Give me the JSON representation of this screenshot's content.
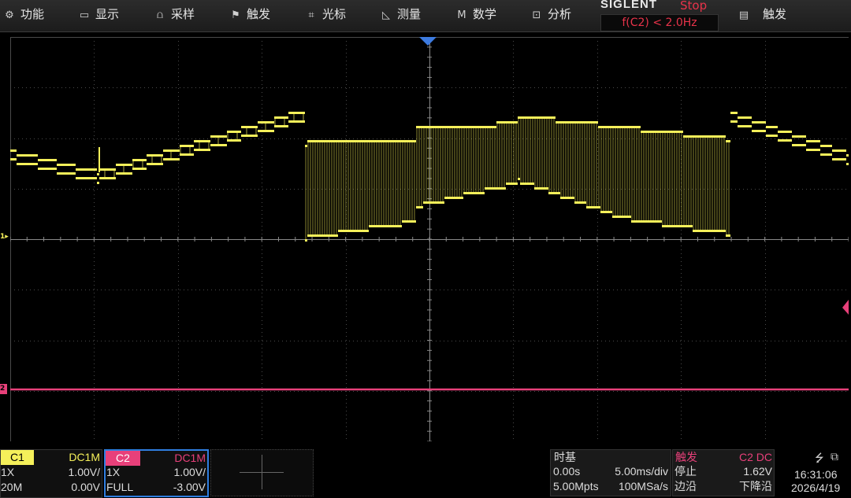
{
  "menu": {
    "items": [
      {
        "id": "function",
        "label": "功能",
        "icon": "gear-icon",
        "glyph": "⚙"
      },
      {
        "id": "display",
        "label": "显示",
        "icon": "monitor-icon",
        "glyph": "▭"
      },
      {
        "id": "acquire",
        "label": "采样",
        "icon": "acquire-icon",
        "glyph": "⩍"
      },
      {
        "id": "trigger",
        "label": "触发",
        "icon": "flag-icon",
        "glyph": "⚑"
      },
      {
        "id": "cursor",
        "label": "光标",
        "icon": "cursor-icon",
        "glyph": "⌗"
      },
      {
        "id": "measure",
        "label": "测量",
        "icon": "measure-icon",
        "glyph": "◺"
      },
      {
        "id": "math",
        "label": "数学",
        "icon": "math-icon",
        "glyph": "M"
      },
      {
        "id": "analyze",
        "label": "分析",
        "icon": "analyze-icon",
        "glyph": "⊡"
      },
      {
        "id": "trigger-menu",
        "label": "触发",
        "icon": "list-icon",
        "glyph": "▤"
      }
    ]
  },
  "brand": "SIGLENT",
  "run_status": "Stop",
  "frequency": "f(C2) < 2.0Hz",
  "markers": {
    "ch1": "1",
    "ch2": "2"
  },
  "ch1": {
    "name": "C1",
    "coupling": "DC1M",
    "probe": "1X",
    "scale": "1.00V/",
    "bw": "20M",
    "offset": "0.00V",
    "color": "#f5f05a"
  },
  "ch2": {
    "name": "C2",
    "coupling": "DC1M",
    "probe": "1X",
    "scale": "1.00V/",
    "bw": "FULL",
    "offset": "-3.00V",
    "color": "#e8407a"
  },
  "timebase": {
    "title": "时基",
    "delay": "0.00s",
    "scale": "5.00ms/div",
    "depth": "5.00Mpts",
    "rate": "100MSa/s"
  },
  "trigger": {
    "title": "触发",
    "source": "C2 DC",
    "state": "停止",
    "level": "1.62V",
    "type": "边沿",
    "slope": "下降沿"
  },
  "clock": {
    "time": "16:31:06",
    "date": "2026/4/19",
    "usb_icon": "usb-icon",
    "network_icon": "network-icon"
  },
  "colors": {
    "grid": "#555555",
    "ch1": "#f5f05a",
    "ch2": "#e8407a",
    "accent": "#2f7ee0"
  }
}
